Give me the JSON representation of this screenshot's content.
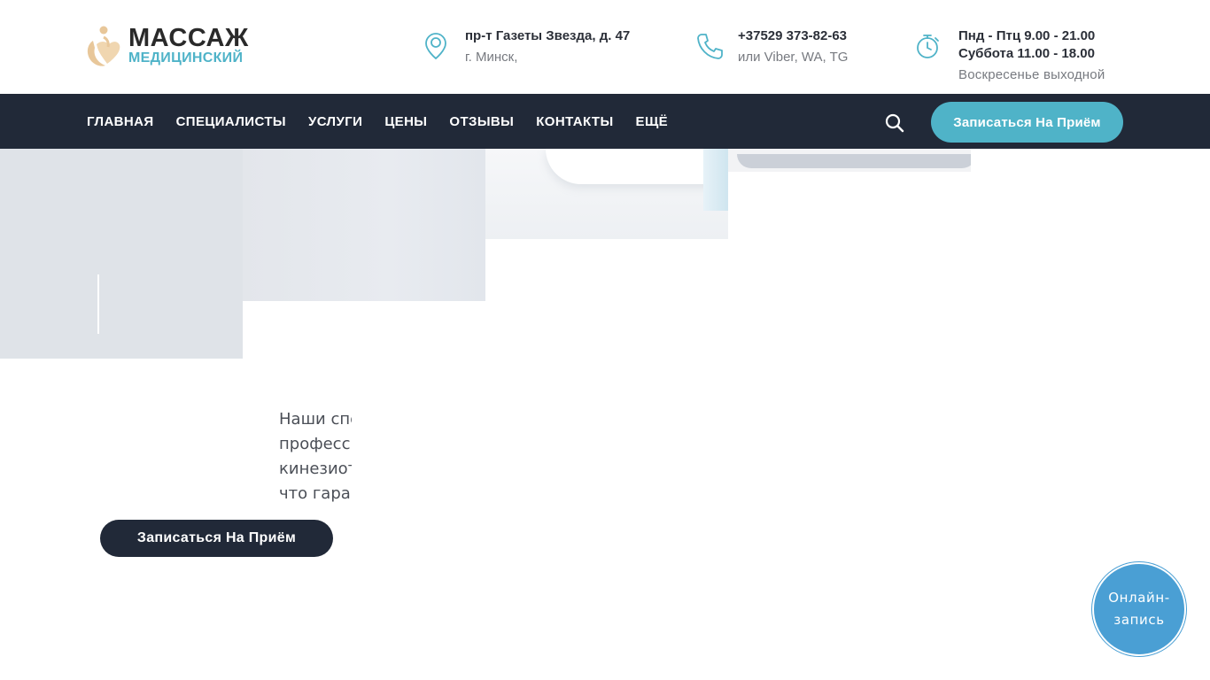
{
  "header": {
    "logo": {
      "title": "МАССАЖ",
      "subtitle": "МЕДИЦИНСКИЙ",
      "icon": "massage-logo-icon"
    },
    "address": {
      "icon": "location-pin-icon",
      "main": "пр-т Газеты Звезда, д. 47",
      "sub": "г. Минск,"
    },
    "phone": {
      "icon": "phone-icon",
      "main": "+37529 373-82-63",
      "sub": "или Viber, WA, TG"
    },
    "hours": {
      "icon": "stopwatch-icon",
      "line1": "Пнд - Птц 9.00 - 21.00",
      "line2": "Суббота 11.00 - 18.00",
      "line3": "Воскресенье выходной"
    }
  },
  "nav": {
    "items": [
      {
        "label": "ГЛАВНАЯ"
      },
      {
        "label": "СПЕЦИАЛИСТЫ"
      },
      {
        "label": "УСЛУГИ"
      },
      {
        "label": "ЦЕНЫ"
      },
      {
        "label": "ОТЗЫВЫ"
      },
      {
        "label": "КОНТАКТЫ"
      },
      {
        "label": "ЕЩЁ"
      }
    ],
    "search_icon": "search-icon",
    "cta_label": "Записаться На Приём"
  },
  "hero": {
    "text_lines": [
      "Наши спе",
      "професси",
      "кинезиот",
      "что гара"
    ],
    "cta_label": "Записаться На Приём"
  },
  "floating": {
    "online_label": "Онлайн-запись"
  },
  "colors": {
    "accent": "#4fb3c8",
    "dark": "#212938",
    "logo_gold": "#e8c79a",
    "online_blue": "#4a9fd4"
  }
}
